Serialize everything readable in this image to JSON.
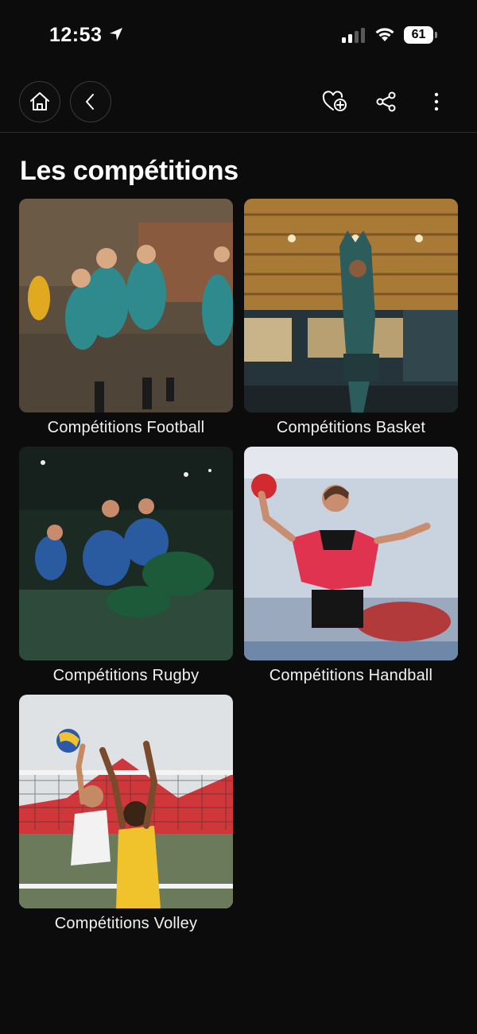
{
  "status_bar": {
    "time": "12:53",
    "battery": "61"
  },
  "header": {
    "title": "Les compétitions"
  },
  "competitions": [
    {
      "label": "Compétitions Football"
    },
    {
      "label": "Compétitions Basket"
    },
    {
      "label": "Compétitions Rugby"
    },
    {
      "label": "Compétitions Handball"
    },
    {
      "label": "Compétitions Volley"
    }
  ]
}
